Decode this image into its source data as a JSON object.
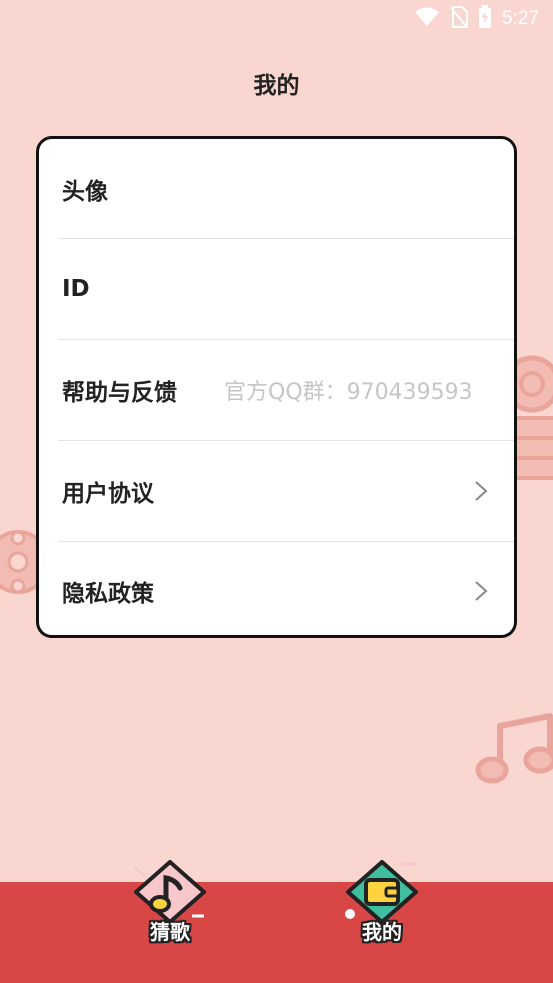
{
  "status_bar": {
    "time": "5:27",
    "icons": [
      "wifi-icon",
      "no-sim-icon",
      "battery-charging-icon"
    ]
  },
  "header": {
    "title": "我的"
  },
  "settings": {
    "items": [
      {
        "label": "头像",
        "value": "",
        "has_chevron": false
      },
      {
        "label": "ID",
        "value": "",
        "has_chevron": false
      },
      {
        "label": "帮助与反馈",
        "value": "官方QQ群：970439593",
        "has_chevron": false
      },
      {
        "label": "用户协议",
        "value": "",
        "has_chevron": true
      },
      {
        "label": "隐私政策",
        "value": "",
        "has_chevron": true
      }
    ]
  },
  "bottom_nav": {
    "items": [
      {
        "label": "猜歌",
        "icon": "music-note-icon",
        "selected": false
      },
      {
        "label": "我的",
        "icon": "wallet-icon",
        "selected": true
      }
    ]
  },
  "colors": {
    "background": "#f9d6cf",
    "nav_bar": "#d84646",
    "card": "#ffffff",
    "card_border": "#111111",
    "hint_text": "#c6c6c6",
    "tab_active": "#3fbf9f",
    "tab_inactive": "#f7c7cc"
  }
}
